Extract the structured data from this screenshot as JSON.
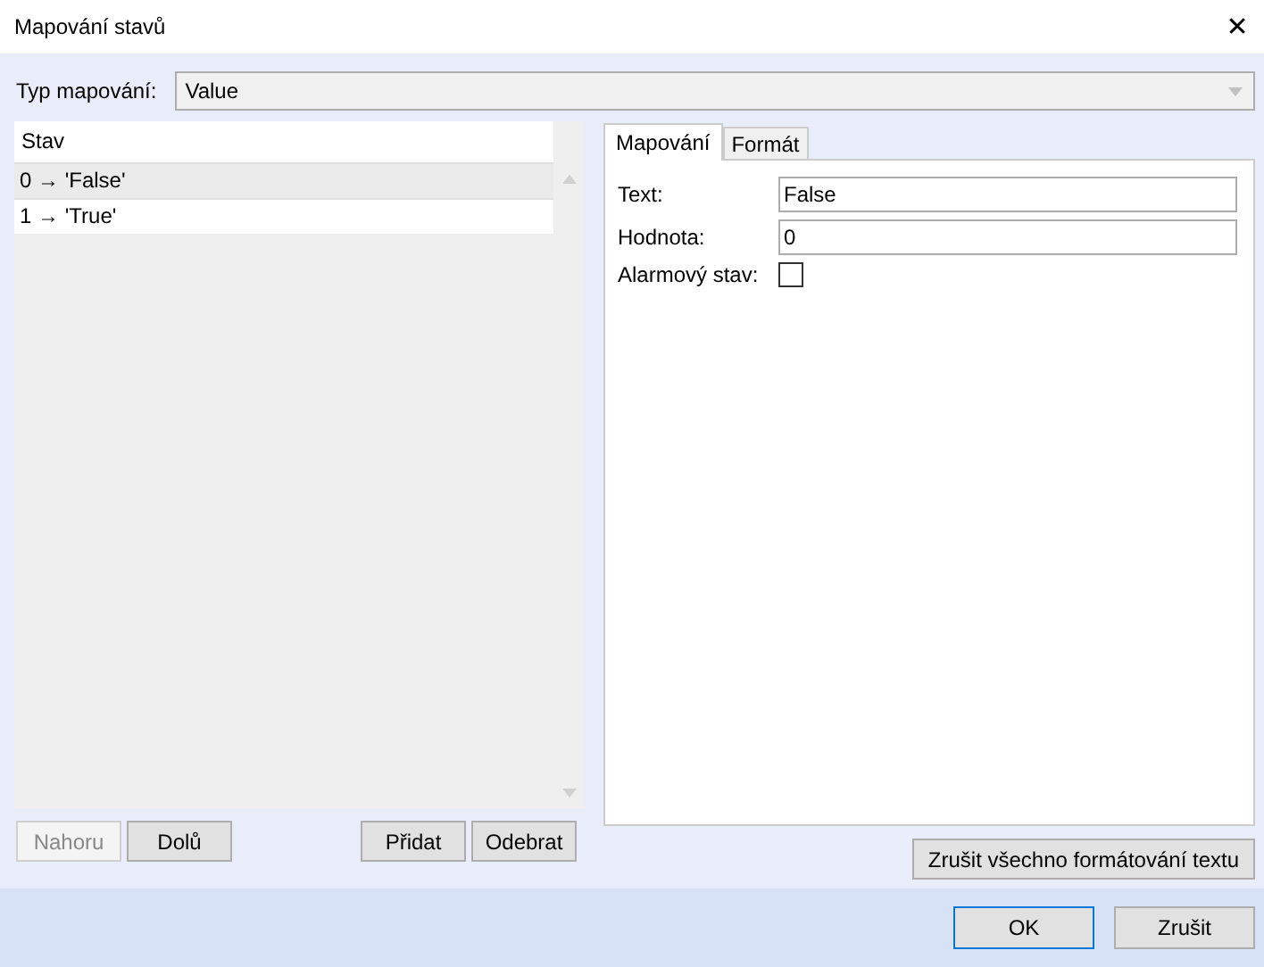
{
  "window": {
    "title": "Mapování stavů",
    "close": "✕"
  },
  "mapping_type": {
    "label": "Typ mapování:",
    "value": "Value"
  },
  "list": {
    "header": "Stav",
    "rows": [
      {
        "text": "0 → 'False'",
        "selected": true
      },
      {
        "text": "1 → 'True'",
        "selected": false
      }
    ]
  },
  "tabs": [
    {
      "label": "Mapování",
      "selected": true
    },
    {
      "label": "Formát",
      "selected": false
    }
  ],
  "form": {
    "text_label": "Text:",
    "text_value": "False",
    "value_label": "Hodnota:",
    "value_value": "0",
    "alarm_label": "Alarmový stav:",
    "alarm_checked": false
  },
  "list_buttons": [
    {
      "label": "Nahoru",
      "disabled": true
    },
    {
      "label": "Dolů",
      "disabled": false
    },
    {
      "label": "Přidat",
      "disabled": false
    },
    {
      "label": "Odebrat",
      "disabled": false
    }
  ],
  "reset_button": "Zrušit všechno formátování textu",
  "footer_buttons": [
    {
      "label": "OK",
      "default": true
    },
    {
      "label": "Zrušit",
      "default": false
    }
  ]
}
